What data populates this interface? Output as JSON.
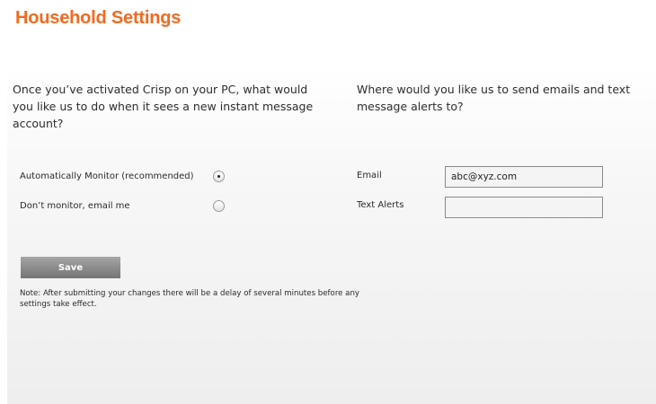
{
  "page": {
    "title": "Household Settings",
    "accent_color": "#f26a22"
  },
  "monitoring": {
    "question": "Once you’ve activated Crisp on your PC, what would you like us to do when it sees a new instant message account?",
    "options": [
      {
        "label": "Automatically Monitor (recommended)",
        "selected": true
      },
      {
        "label": "Don’t monitor, email me",
        "selected": false
      }
    ]
  },
  "alerts": {
    "question": "Where would you like us to send emails and text message alerts to?",
    "email_label": "Email",
    "email_value": "abc@xyz.com",
    "text_alerts_label": "Text Alerts",
    "text_alerts_value": ""
  },
  "actions": {
    "save_label": "Save"
  },
  "note": "Note: After submitting your changes there will be a delay of several minutes before any settings take effect."
}
